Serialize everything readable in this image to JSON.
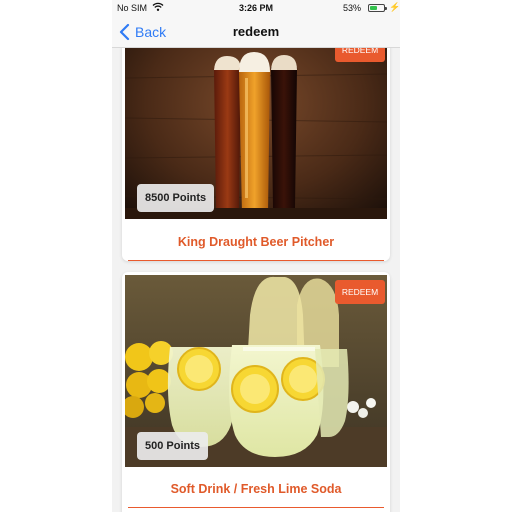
{
  "status_bar": {
    "carrier": "No SIM",
    "time": "3:26 PM",
    "battery_percent": "53%",
    "battery_level": 0.53,
    "wifi_icon": "wifi-icon",
    "charging_icon": "lightning-bolt-icon"
  },
  "nav": {
    "back_label": "Back",
    "title": "redeem"
  },
  "rewards": [
    {
      "points_label": "8500 Points",
      "name": "King Draught Beer Pitcher",
      "redeem_label": "REDEEM",
      "image": "beer-glasses-image"
    },
    {
      "points_label": "500 Points",
      "name": "Soft Drink / Fresh Lime Soda",
      "redeem_label": "REDEEM",
      "image": "lime-soda-image"
    }
  ],
  "colors": {
    "accent": "#e95a2e",
    "link": "#2f7bf5",
    "background": "#f2f2f2",
    "battery": "#33c24d"
  }
}
